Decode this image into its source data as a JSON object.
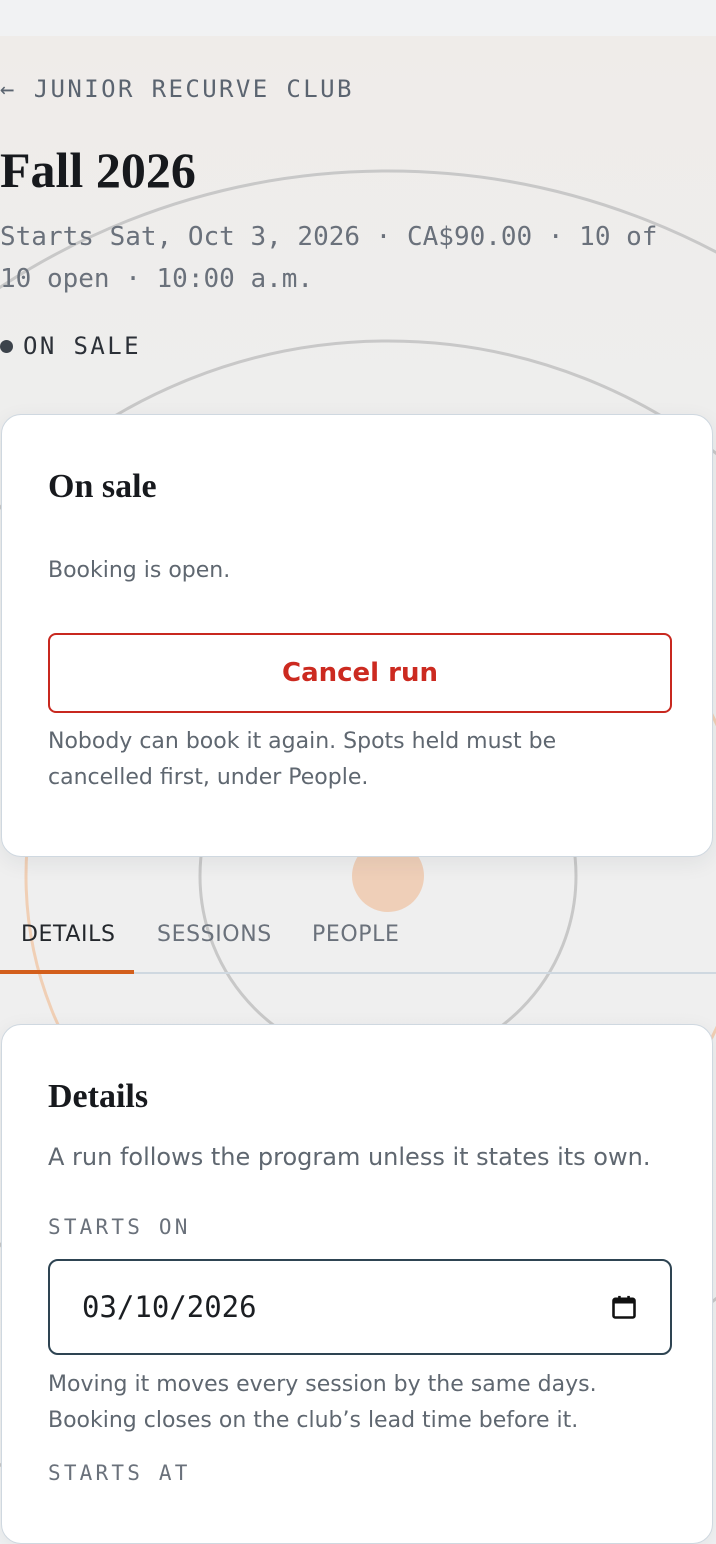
{
  "header": {
    "back_label": "← JUNIOR RECURVE CLUB",
    "title": "Fall 2026",
    "meta_lines": [
      "Starts Sat, Oct 3, 2026 · CA$90.00 · 10 of",
      "10 open · 10:00 a.m."
    ],
    "status": "ON SALE"
  },
  "sale_card": {
    "heading": "On sale",
    "body": "Booking is open.",
    "cancel_label": "Cancel run",
    "note_lines": [
      "Nobody can book it again. Spots held must be",
      "cancelled first, under People."
    ]
  },
  "tabs": [
    {
      "label": "DETAILS",
      "active": true
    },
    {
      "label": "SESSIONS",
      "active": false
    },
    {
      "label": "PEOPLE",
      "active": false
    }
  ],
  "details": {
    "heading": "Details",
    "intro": "A run follows the program unless it states its own.",
    "starts_on_label": "STARTS ON",
    "starts_on_value": "03/10/2026",
    "help_lines": [
      "Moving it moves every session by the same days.",
      "Booking closes on the club’s lead time before it."
    ],
    "next_label": "STARTS AT"
  },
  "colors": {
    "accent": "#d35f1c",
    "danger": "#c8281f",
    "field_border": "#2e4452",
    "card_border": "#cfd8e0"
  },
  "icons": {
    "back": "arrow-left-icon",
    "status": "status-dot-icon",
    "date_picker": "calendar-icon"
  }
}
